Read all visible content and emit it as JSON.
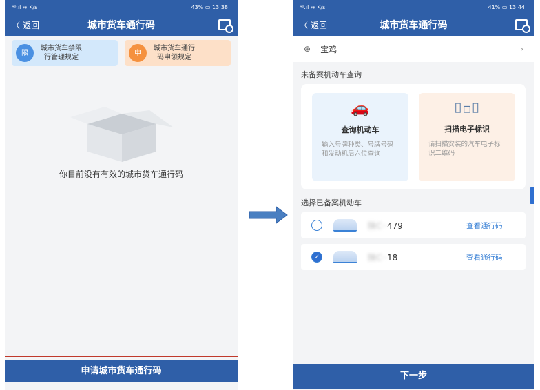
{
  "left_screen": {
    "status": {
      "signal": "⁴⁶.ıl ≋ K/s",
      "battery": "43%",
      "time": "13:38"
    },
    "nav": {
      "back_label": "返回",
      "title": "城市货车通行码"
    },
    "rule_cards": [
      {
        "label_l1": "城市货车禁限",
        "label_l2": "行管理规定",
        "icon_text": "限",
        "color": "#4a90e2"
      },
      {
        "label_l1": "城市货车通行",
        "label_l2": "码申领规定",
        "icon_text": "申",
        "color": "#f5913e"
      }
    ],
    "empty_message": "你目前没有有效的城市货车通行码",
    "apply_button": "申请城市货车通行码"
  },
  "right_screen": {
    "status": {
      "signal": "⁴⁶.ıl ≋ K/s",
      "battery": "41%",
      "time": "13:44"
    },
    "nav": {
      "back_label": "返回",
      "title": "城市货车通行码"
    },
    "city": "宝鸡",
    "unregistered_section": "未备案机动车查询",
    "query_card": {
      "title": "查询机动车",
      "desc": "输入号牌种类、号牌号码和发动机后六位查询"
    },
    "scan_card": {
      "title": "扫描电子标识",
      "desc": "请扫描安装的汽车电子标识二维码"
    },
    "registered_section": "选择已备案机动车",
    "vehicles": [
      {
        "plate_hidden": "陕C··",
        "plate_visible": "479",
        "selected": false,
        "action": "查看通行码"
      },
      {
        "plate_hidden": "陕C··",
        "plate_visible": "18",
        "selected": true,
        "action": "查看通行码"
      }
    ],
    "next_button": "下一步"
  }
}
